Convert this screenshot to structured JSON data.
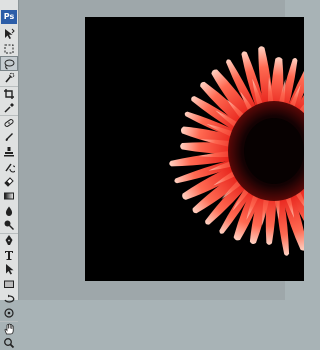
{
  "app": {
    "logo_text": "Ps"
  },
  "colors": {
    "toolbox_bg": "#dfe1e1",
    "workspace_bg": "#9ea7aa",
    "canvas_bg": "#000000",
    "petal_red": "#e8261e",
    "petal_highlight": "#ffd3c4",
    "flower_center": "#140203"
  },
  "toolbox": {
    "tools": [
      {
        "name": "move-tool-icon",
        "active": false
      },
      {
        "name": "marquee-tool-icon",
        "active": false
      },
      {
        "name": "lasso-tool-icon",
        "active": true
      },
      {
        "name": "quick-selection-tool-icon",
        "active": false
      },
      {
        "name": "crop-tool-icon",
        "active": false
      },
      {
        "name": "eyedropper-tool-icon",
        "active": false
      },
      {
        "name": "spot-healing-brush-tool-icon",
        "active": false
      },
      {
        "name": "brush-tool-icon",
        "active": false
      },
      {
        "name": "clone-stamp-tool-icon",
        "active": false
      },
      {
        "name": "history-brush-tool-icon",
        "active": false
      },
      {
        "name": "eraser-tool-icon",
        "active": false
      },
      {
        "name": "gradient-tool-icon",
        "active": false
      },
      {
        "name": "blur-tool-icon",
        "active": false
      },
      {
        "name": "dodge-tool-icon",
        "active": false
      },
      {
        "name": "pen-tool-icon",
        "active": false
      },
      {
        "name": "type-tool-icon",
        "active": false
      },
      {
        "name": "path-selection-tool-icon",
        "active": false
      },
      {
        "name": "rectangle-tool-icon",
        "active": false
      },
      {
        "name": "3d-rotate-tool-icon",
        "active": false
      },
      {
        "name": "3d-camera-tool-icon",
        "active": false
      },
      {
        "name": "hand-tool-icon",
        "active": false
      },
      {
        "name": "zoom-tool-icon",
        "active": false
      }
    ]
  },
  "document": {
    "image_subject": "red-gerbera-flower-image"
  }
}
